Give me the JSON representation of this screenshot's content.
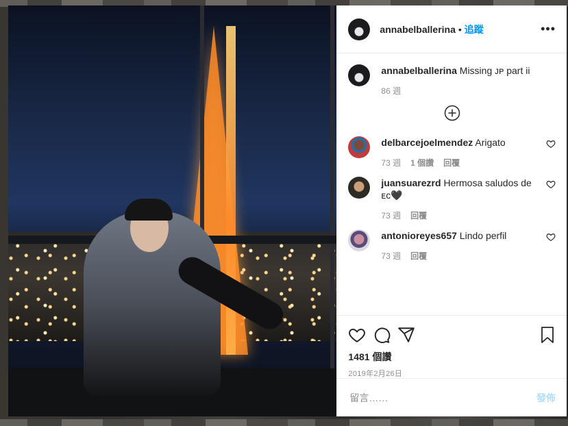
{
  "post": {
    "username": "annabelballerina",
    "follow_label": "追蹤",
    "more_label": "•••",
    "caption_user": "annabelballerina",
    "caption_text": "Missing ᴊᴘ part ii",
    "caption_time": "86 週"
  },
  "comments": [
    {
      "user": "delbarcejoelmendez",
      "text": "Arigato",
      "time": "73 週",
      "likes": "1 個讚",
      "reply": "回覆"
    },
    {
      "user": "juansuarezrd",
      "text": "Hermosa saludos de ᴇᴄ🖤",
      "time": "73 週",
      "reply": "回覆"
    },
    {
      "user": "antonioreyes657",
      "text": "Lindo perfil",
      "time": "73 週",
      "reply": "回覆"
    }
  ],
  "actions": {
    "likes_count": "1481 個讚",
    "date": "2019年2月26日"
  },
  "comment_box": {
    "placeholder": "留言……",
    "post_label": "發佈"
  },
  "colors": {
    "link_blue": "#0095f6",
    "post_disabled": "#b2dffc",
    "text_primary": "#262626",
    "text_secondary": "#8e8e8e"
  }
}
